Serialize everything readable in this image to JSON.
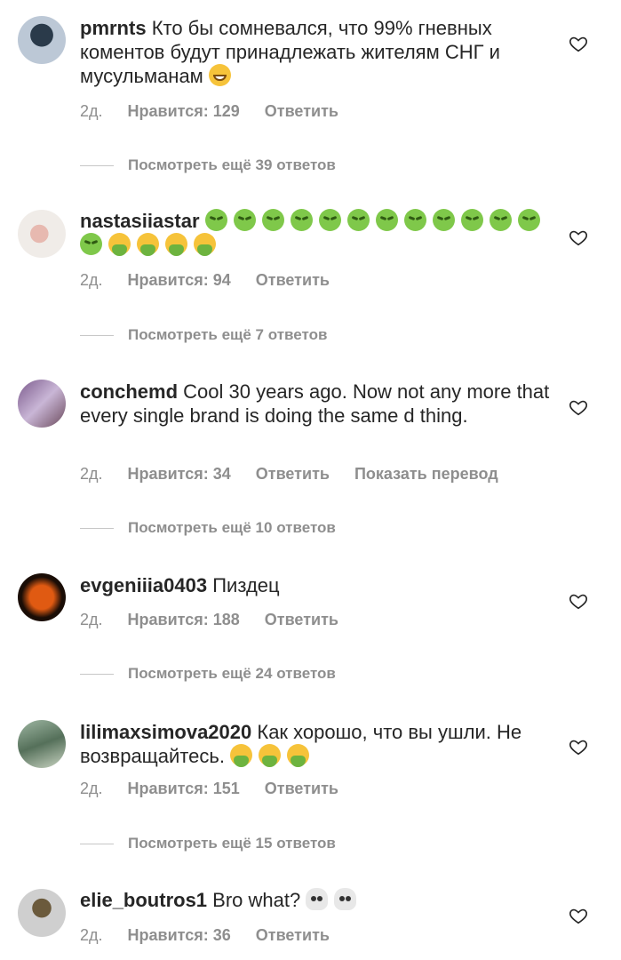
{
  "comments": [
    {
      "user": "pmrnts",
      "text": "Кто бы сомневался, что 99% гневных коментов будут принадлежать жителям СНГ и мусульманам",
      "emoji": [
        "grin"
      ],
      "age": "2д.",
      "likes": "Нравится: 129",
      "reply": "Ответить",
      "translate": "",
      "view_replies": "Посмотреть ещё 39 ответов"
    },
    {
      "user": "nastasiiastar",
      "text": "",
      "emoji": [
        "sick",
        "sick",
        "sick",
        "sick",
        "sick",
        "sick",
        "sick",
        "sick",
        "sick",
        "sick",
        "sick",
        "sick",
        "sick",
        "vomit",
        "vomit",
        "vomit",
        "vomit"
      ],
      "age": "2д.",
      "likes": "Нравится: 94",
      "reply": "Ответить",
      "translate": "",
      "view_replies": "Посмотреть ещё 7 ответов"
    },
    {
      "user": "conchemd",
      "text": "Cool 30 years ago. Now not any more that every single brand is doing the same d thing.",
      "emoji": [],
      "age": "2д.",
      "likes": "Нравится: 34",
      "reply": "Ответить",
      "translate": "Показать перевод",
      "view_replies": "Посмотреть ещё 10 ответов"
    },
    {
      "user": "evgeniiia0403",
      "text": "Пиздец",
      "emoji": [],
      "age": "2д.",
      "likes": "Нравится: 188",
      "reply": "Ответить",
      "translate": "",
      "view_replies": "Посмотреть ещё 24 ответов"
    },
    {
      "user": "lilimaxsimova2020",
      "text": "Как хорошо, что вы ушли. Не возвращайтесь.",
      "emoji": [
        "vomit",
        "vomit",
        "vomit"
      ],
      "age": "2д.",
      "likes": "Нравится: 151",
      "reply": "Ответить",
      "translate": "",
      "view_replies": "Посмотреть ещё 15 ответов"
    },
    {
      "user": "elie_boutros1",
      "text": "Bro what?",
      "emoji": [
        "skull",
        "skull"
      ],
      "age": "2д.",
      "likes": "Нравится: 36",
      "reply": "Ответить",
      "translate": "",
      "view_replies": ""
    }
  ]
}
